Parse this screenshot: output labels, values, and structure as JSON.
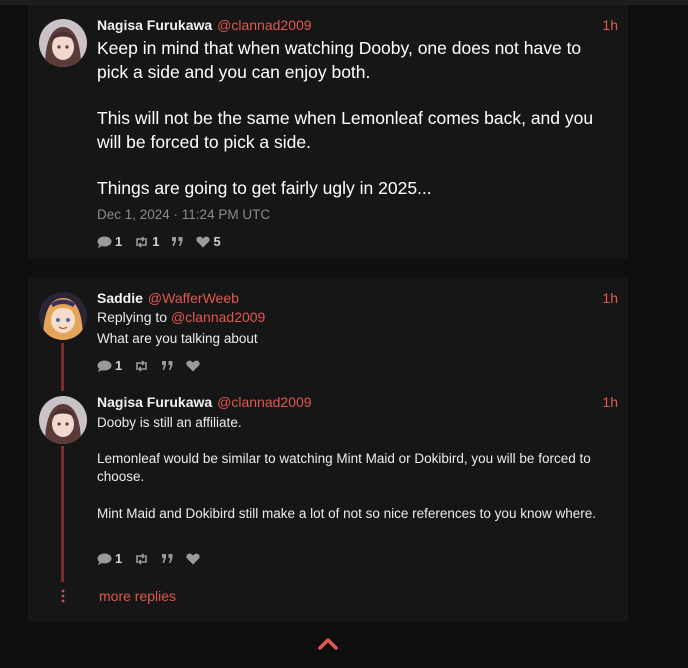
{
  "main_post": {
    "author": "Nagisa Furukawa",
    "handle": "@clannad2009",
    "time": "1h",
    "paragraphs": [
      "Keep in mind that when watching Dooby, one does not have to pick a side and you can enjoy both.",
      "This will not be the same when Lemonleaf comes back, and you will be forced to pick a side.",
      "Things are going to get fairly ugly in 2025..."
    ],
    "timestamp": "Dec 1, 2024 · 11:24 PM UTC",
    "stats": {
      "replies": "1",
      "reposts": "1",
      "likes": "5"
    }
  },
  "thread": {
    "reply1": {
      "author": "Saddie",
      "handle": "@WafferWeeb",
      "time": "1h",
      "replying_label": "Replying to",
      "replying_to": "@clannad2009",
      "text": "What are you talking about",
      "stats": {
        "replies": "1"
      }
    },
    "reply2": {
      "author": "Nagisa Furukawa",
      "handle": "@clannad2009",
      "time": "1h",
      "paragraphs": [
        "Dooby is still an affiliate.",
        "Lemonleaf would be similar to watching Mint Maid or Dokibird, you will be forced to choose.",
        "Mint Maid and Dokibird still make a lot of not so nice references to you know where."
      ],
      "stats": {
        "replies": "1"
      }
    },
    "more_replies": "more replies"
  },
  "icons": {
    "reply": "comment-icon",
    "repost": "retweet-icon",
    "quote": "quote-icon",
    "like": "heart-icon",
    "scroll_top": "chevron-up-icon"
  },
  "colors": {
    "accent": "#e0584f",
    "card": "#161616",
    "background": "#0f0f0f"
  }
}
